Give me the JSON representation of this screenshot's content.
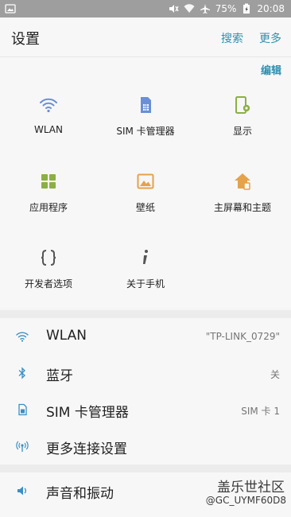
{
  "status_bar": {
    "battery": "75%",
    "time": "20:08",
    "icons": [
      "image-icon",
      "mute-icon",
      "wifi-icon",
      "airplane-icon",
      "battery-charging-icon"
    ]
  },
  "header": {
    "title": "设置",
    "search": "搜索",
    "more": "更多"
  },
  "quick_settings": {
    "edit": "编辑",
    "items": [
      {
        "label": "WLAN",
        "icon": "wifi-icon"
      },
      {
        "label": "SIM 卡管理器",
        "icon": "sim-card-icon"
      },
      {
        "label": "显示",
        "icon": "display-icon"
      },
      {
        "label": "应用程序",
        "icon": "apps-grid-icon"
      },
      {
        "label": "壁纸",
        "icon": "wallpaper-icon"
      },
      {
        "label": "主屏幕和主题",
        "icon": "home-theme-icon"
      },
      {
        "label": "开发者选项",
        "icon": "developer-braces-icon"
      },
      {
        "label": "关于手机",
        "icon": "info-icon"
      }
    ]
  },
  "settings_list": {
    "items": [
      {
        "label": "WLAN",
        "value": "\"TP-LINK_0729\"",
        "icon": "wifi-icon"
      },
      {
        "label": "蓝牙",
        "value": "关",
        "icon": "bluetooth-icon"
      },
      {
        "label": "SIM 卡管理器",
        "value": "SIM 卡 1",
        "icon": "sim-card-icon"
      },
      {
        "label": "更多连接设置",
        "value": "",
        "icon": "more-connections-icon"
      },
      {
        "label": "声音和振动",
        "value": "",
        "icon": "volume-icon"
      }
    ]
  },
  "watermark": {
    "line1": "盖乐世社区",
    "line2": "@GC_UYMF60D8"
  },
  "colors": {
    "accent": "#2f8fb0",
    "icon_blue": "#6b8fd6",
    "icon_green": "#8bb043",
    "icon_orange": "#e5a24b",
    "status_bar": "#9e9e9e"
  }
}
